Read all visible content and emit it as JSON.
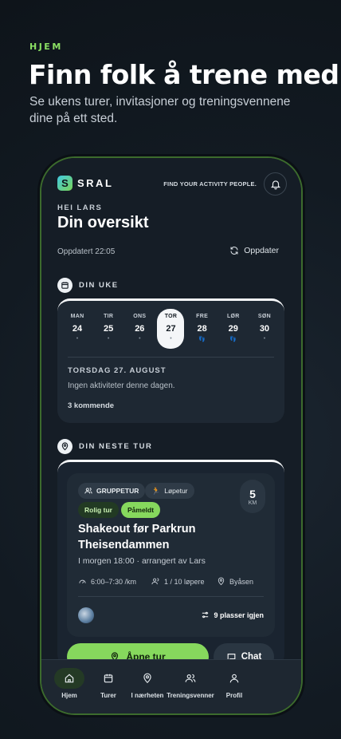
{
  "hero": {
    "eyebrow": "HJEM",
    "headline": "Finn folk å trene med",
    "subline": "Se ukens turer, invitasjoner og treningsvennene dine på ett sted."
  },
  "app": {
    "brand": "SRAL",
    "logo_letter": "S",
    "tagline": "FIND YOUR ACTIVITY PEOPLE.",
    "greeting": "HEI LARS",
    "title": "Din oversikt",
    "updated": "Oppdatert 22:05",
    "refresh_label": "Oppdater"
  },
  "week": {
    "heading": "DIN UKE",
    "days": [
      {
        "name": "MAN",
        "date": "24",
        "mark": "•"
      },
      {
        "name": "TIR",
        "date": "25",
        "mark": "•"
      },
      {
        "name": "ONS",
        "date": "26",
        "mark": "•"
      },
      {
        "name": "TOR",
        "date": "27",
        "mark": "•"
      },
      {
        "name": "FRE",
        "date": "28",
        "mark": "👣"
      },
      {
        "name": "LØR",
        "date": "29",
        "mark": "👣"
      },
      {
        "name": "SØN",
        "date": "30",
        "mark": "•"
      }
    ],
    "selected_index": 3,
    "selected_date_label": "TORSDAG 27. AUGUST",
    "empty_text": "Ingen aktiviteter denne dagen.",
    "upcoming": "3 kommende"
  },
  "next_trip": {
    "heading": "DIN NESTE TUR",
    "chip_type": "GRUPPETUR",
    "chip_activity": "Løpetur",
    "chip_pace": "Rolig tur",
    "chip_status": "Påmeldt",
    "distance_value": "5",
    "distance_unit": "KM",
    "title": "Shakeout før Parkrun Theisendammen",
    "subtitle": "I morgen 18:00 · arrangert av Lars",
    "pace": "6:00–7:30 /km",
    "runners": "1 / 10 løpere",
    "location": "Byåsen",
    "spots_left": "9 plasser igjen",
    "open_button": "Åpne tur",
    "chat_button": "Chat"
  },
  "tabs": [
    {
      "label": "Hjem",
      "icon": "home-icon"
    },
    {
      "label": "Turer",
      "icon": "calendar-icon"
    },
    {
      "label": "I nærheten",
      "icon": "location-pin-icon"
    },
    {
      "label": "Treningsvenner",
      "icon": "people-icon"
    },
    {
      "label": "Profil",
      "icon": "person-icon"
    }
  ],
  "colors": {
    "accent": "#86d85d",
    "background": "#121a22",
    "card": "#1e2833",
    "phone_border": "#3c6b2d"
  }
}
